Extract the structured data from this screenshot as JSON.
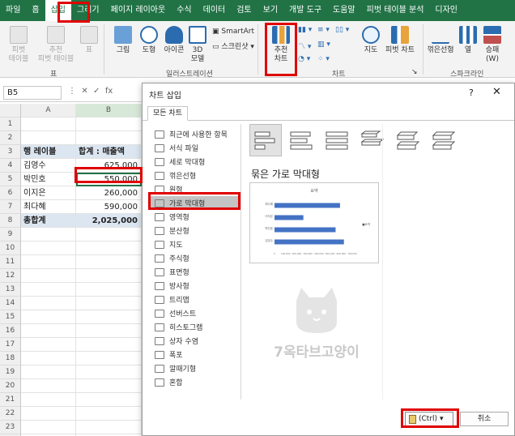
{
  "ribbon_tabs": [
    "파일",
    "홈",
    "삽입",
    "그리기",
    "페이지 레이아웃",
    "수식",
    "데이터",
    "검토",
    "보기",
    "개발 도구",
    "도움말",
    "피벗 테이블 분석",
    "디자인"
  ],
  "active_tab": "삽입",
  "ribbon": {
    "pivot_table": "피벗\n테이블",
    "recommended_pivot": "추천\n피벗 테이블",
    "table": "표",
    "group_table": "표",
    "picture": "그림",
    "shapes": "도형",
    "icons": "아이콘",
    "model3d": "3D\n모델",
    "smartart": "SmartArt",
    "screenshot": "스크린샷",
    "group_illustration": "일러스트레이션",
    "recommended_chart": "추천\n차트",
    "group_chart": "차트",
    "map": "지도",
    "pivot_chart": "피벗 차트",
    "line": "꺾은선형",
    "column": "열",
    "winloss": "승패\n(W)",
    "group_sparkline": "스파크라인"
  },
  "namebox": "B5",
  "fx": "fx",
  "columns": [
    "A",
    "B"
  ],
  "rows": [
    {
      "n": "1",
      "a": "",
      "b": ""
    },
    {
      "n": "2",
      "a": "",
      "b": ""
    },
    {
      "n": "3",
      "a": "행 레이블",
      "b": "합계 : 매출액"
    },
    {
      "n": "4",
      "a": "김영수",
      "b": "625,000"
    },
    {
      "n": "5",
      "a": "박민호",
      "b": "550,000"
    },
    {
      "n": "6",
      "a": "이지은",
      "b": "260,000"
    },
    {
      "n": "7",
      "a": "최다혜",
      "b": "590,000"
    },
    {
      "n": "8",
      "a": "총합계",
      "b": "2,025,000"
    },
    {
      "n": "9",
      "a": "",
      "b": ""
    },
    {
      "n": "10",
      "a": "",
      "b": ""
    },
    {
      "n": "11",
      "a": "",
      "b": ""
    },
    {
      "n": "12",
      "a": "",
      "b": ""
    },
    {
      "n": "13",
      "a": "",
      "b": ""
    },
    {
      "n": "14",
      "a": "",
      "b": ""
    },
    {
      "n": "15",
      "a": "",
      "b": ""
    },
    {
      "n": "16",
      "a": "",
      "b": ""
    },
    {
      "n": "17",
      "a": "",
      "b": ""
    },
    {
      "n": "18",
      "a": "",
      "b": ""
    },
    {
      "n": "19",
      "a": "",
      "b": ""
    },
    {
      "n": "20",
      "a": "",
      "b": ""
    },
    {
      "n": "21",
      "a": "",
      "b": ""
    },
    {
      "n": "22",
      "a": "",
      "b": ""
    },
    {
      "n": "23",
      "a": "",
      "b": ""
    },
    {
      "n": "24",
      "a": "",
      "b": ""
    }
  ],
  "dialog": {
    "title": "차트 삽입",
    "help": "?",
    "close": "✕",
    "tab": "모든 차트",
    "chart_types": [
      "최근에 사용한 항목",
      "서식 파일",
      "세로 막대형",
      "꺾은선형",
      "원형",
      "가로 막대형",
      "영역형",
      "분산형",
      "지도",
      "주식형",
      "표면형",
      "방사형",
      "트리맵",
      "선버스트",
      "히스토그램",
      "상자 수염",
      "폭포",
      "깔때기형",
      "혼합"
    ],
    "selected_type": "가로 막대형",
    "subtype_title": "묶은 가로 막대형",
    "paste_label": "(Ctrl)",
    "cancel": "취소"
  },
  "watermark": "7옥타브고양이",
  "preview": {
    "title": "요약",
    "legend": "■요약",
    "categories": [
      "최다혜",
      "이지은",
      "박민호",
      "김영수"
    ],
    "values": [
      590000,
      260000,
      550000,
      625000
    ],
    "ticks": [
      "0",
      "100,000",
      "200,000",
      "300,000",
      "400,000",
      "500,000",
      "600,000",
      "700,000"
    ],
    "xlim": [
      0,
      700000
    ]
  },
  "colors": {
    "excel_green": "#217346",
    "highlight_red": "#e00000",
    "pivot_blue": "#dce6f1",
    "bar_blue": "#4472c4"
  }
}
